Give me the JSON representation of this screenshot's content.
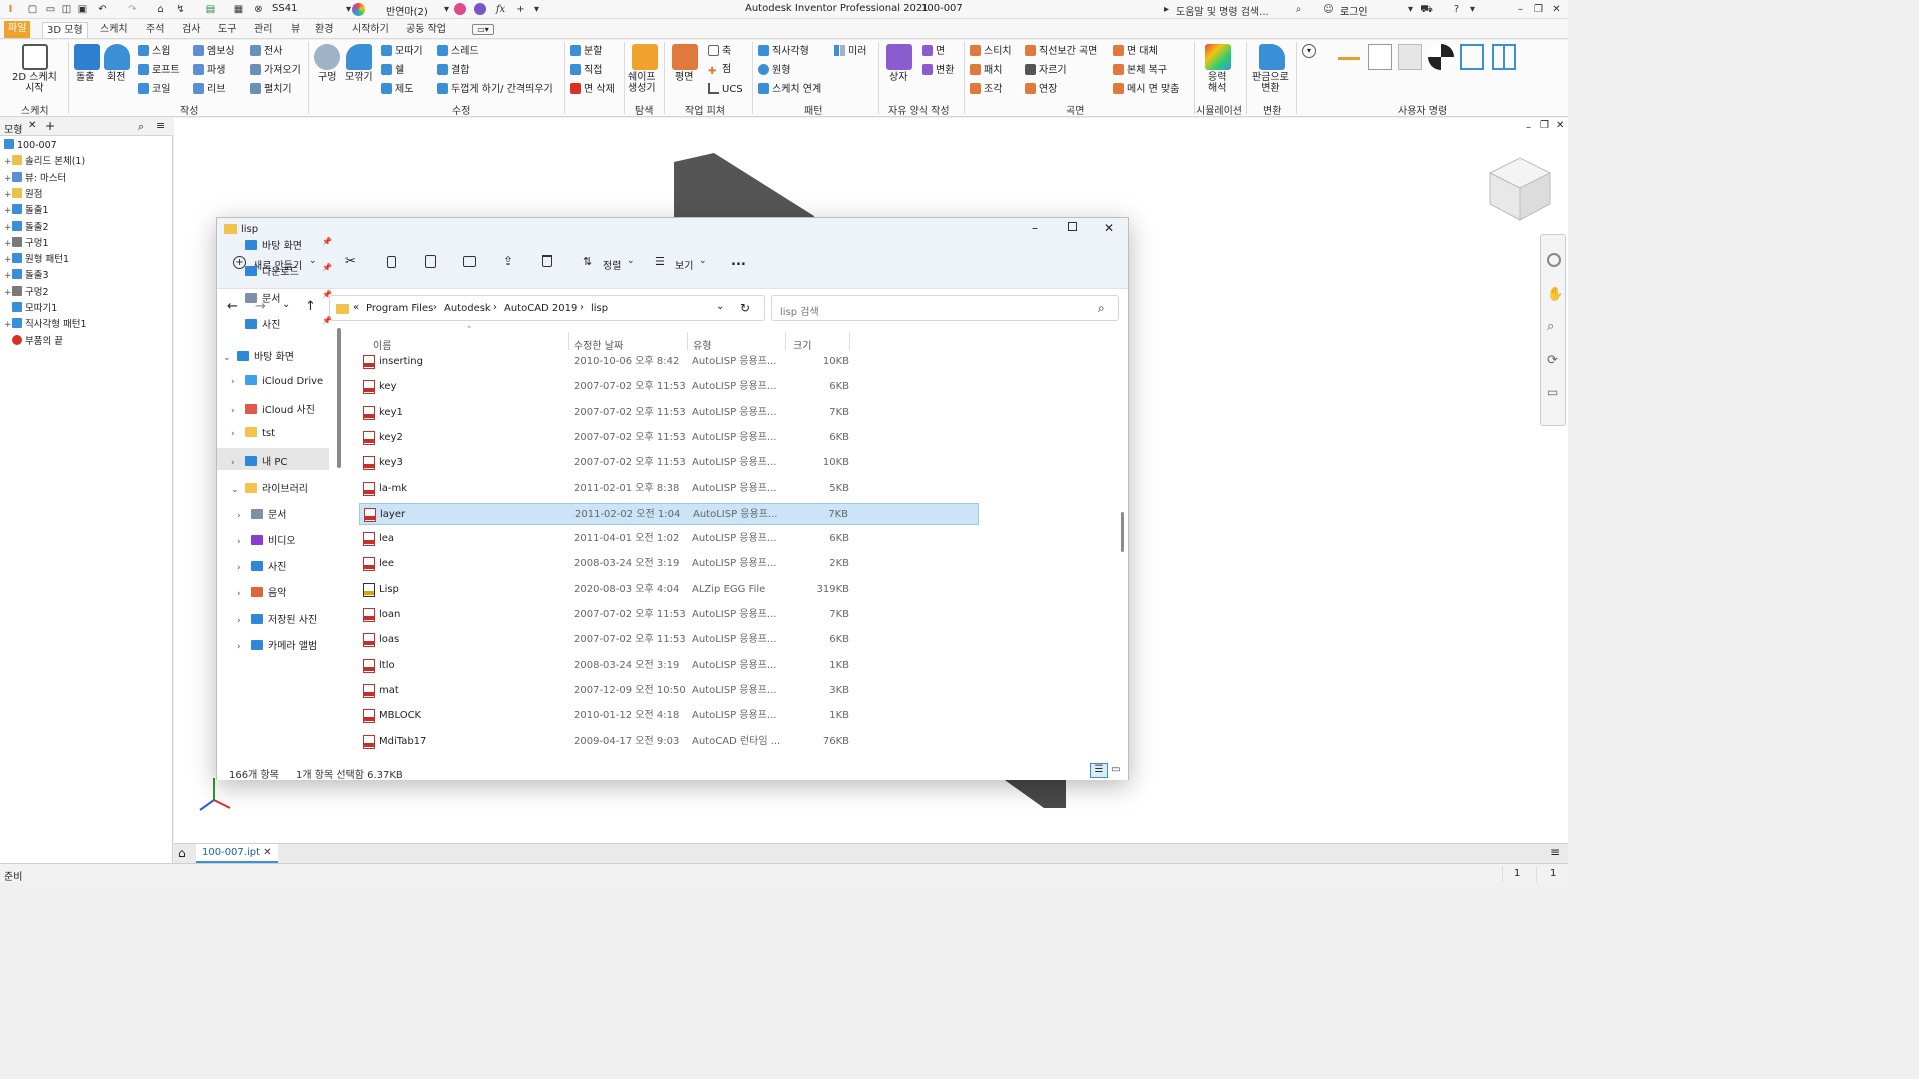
{
  "app": {
    "title": "Autodesk Inventor Professional 2021",
    "doc": "100-007",
    "search_placeholder": "도움말 및 명령 검색...",
    "login": "로그인",
    "style_name": "SS41",
    "appearance": "반연마(2)"
  },
  "ribbon_tabs": [
    "파일",
    "3D 모형",
    "스케치",
    "주석",
    "검사",
    "도구",
    "관리",
    "뷰",
    "환경",
    "시작하기",
    "공동 작업"
  ],
  "ribbon": {
    "sketch_btn": "2D 스케치\n시작",
    "sketch_panel": "스케치",
    "extrude": "돌출",
    "revolve": "회전",
    "sweep": "스윕",
    "loft": "로프트",
    "coil": "코일",
    "emboss": "엠보싱",
    "derive": "파생",
    "rib": "리브",
    "decal": "전사",
    "import": "가져오기",
    "unwrap": "펼치기",
    "create_panel": "작성",
    "hole": "구멍",
    "fillet": "모깎기",
    "chamfer": "모따기",
    "shell": "쉘",
    "draft": "제도",
    "thread": "스레드",
    "combine": "결합",
    "thicken": "두껍게 하기/ 간격띄우기",
    "modify_panel": "수정",
    "split": "분할",
    "direct": "직접",
    "delete_face": "면 삭제",
    "shape_gen": "쉐이프\n생성기",
    "explore_panel": "탐색",
    "plane": "평면",
    "axis": "축",
    "point": "점",
    "ucs": "UCS",
    "workfeat_panel": "작업 피쳐",
    "rect_pattern": "직사각형",
    "circ_pattern": "원형",
    "sketch_driven": "스케치 연계",
    "mirror": "미러",
    "pattern_panel": "패턴",
    "box": "상자",
    "face": "면",
    "convert": "변환",
    "freeform_panel": "자유 양식 작성",
    "stitch": "스티치",
    "patch": "패치",
    "sculpt": "조각",
    "ruled": "직선보간 곡면",
    "trim": "자르기",
    "extend": "연장",
    "replace_face": "면 대체",
    "repair": "본체 복구",
    "mesh_face": "메시 면 맞춤",
    "surface_panel": "곡면",
    "stress": "응력\n해석",
    "sim_panel": "시뮬레이션",
    "sheetmetal": "판금으로\n변환",
    "convert_panel": "변환",
    "user_panel": "사용자 명령"
  },
  "browser": {
    "tab": "모형",
    "items": [
      {
        "label": "100-007",
        "level": 0,
        "pm": "",
        "color": "#3a8fd6"
      },
      {
        "label": "솔리드 본체(1)",
        "level": 1,
        "pm": "+",
        "color": "#e8c24a"
      },
      {
        "label": "뷰: 마스터",
        "level": 1,
        "pm": "+",
        "color": "#5b8fd1"
      },
      {
        "label": "원점",
        "level": 1,
        "pm": "+",
        "color": "#e8c24a"
      },
      {
        "label": "돌출1",
        "level": 1,
        "pm": "+",
        "color": "#3a8fd6"
      },
      {
        "label": "돌출2",
        "level": 1,
        "pm": "+",
        "color": "#3a8fd6"
      },
      {
        "label": "구멍1",
        "level": 1,
        "pm": "+",
        "color": "#7a7a7a"
      },
      {
        "label": "원형 패턴1",
        "level": 1,
        "pm": "+",
        "color": "#3a8fd6"
      },
      {
        "label": "돌출3",
        "level": 1,
        "pm": "+",
        "color": "#3a8fd6"
      },
      {
        "label": "구멍2",
        "level": 1,
        "pm": "+",
        "color": "#7a7a7a"
      },
      {
        "label": "모따기1",
        "level": 1,
        "pm": "",
        "color": "#3a8fd6"
      },
      {
        "label": "직사각형 패턴1",
        "level": 1,
        "pm": "+",
        "color": "#3a8fd6"
      },
      {
        "label": "부품의 끝",
        "level": 1,
        "pm": "",
        "color": "#d93025"
      }
    ]
  },
  "explorer": {
    "title": "lisp",
    "new_btn": "새로 만들기",
    "sort_btn": "정렬",
    "view_btn": "보기",
    "more": "...",
    "breadcrumb": [
      "Program Files",
      "Autodesk",
      "AutoCAD 2019",
      "lisp"
    ],
    "search_placeholder": "lisp 검색",
    "nav": [
      {
        "label": "바탕 화면",
        "level": 1,
        "pin": true,
        "color": "#2f87d8",
        "chev": ""
      },
      {
        "label": "다운로드",
        "level": 1,
        "pin": true,
        "color": "#2f87d8",
        "chev": ""
      },
      {
        "label": "문서",
        "level": 1,
        "pin": true,
        "color": "#7f8fa6",
        "chev": ""
      },
      {
        "label": "사진",
        "level": 1,
        "pin": true,
        "color": "#2f87d8",
        "chev": ""
      },
      {
        "label": "바탕 화면",
        "level": 0,
        "pin": false,
        "color": "#2f87d8",
        "chev": "v"
      },
      {
        "label": "iCloud Drive",
        "level": 1,
        "pin": false,
        "color": "#3ca0e8",
        "chev": ">"
      },
      {
        "label": "iCloud 사진",
        "level": 1,
        "pin": false,
        "color": "#e0574c",
        "chev": ">"
      },
      {
        "label": "tst",
        "level": 1,
        "pin": false,
        "color": "#f1c34b",
        "chev": ">"
      },
      {
        "label": "내 PC",
        "level": 1,
        "pin": false,
        "color": "#2f87d8",
        "chev": ">"
      },
      {
        "label": "라이브러리",
        "level": 1,
        "pin": false,
        "color": "#f1c34b",
        "chev": "v"
      },
      {
        "label": "문서",
        "level": 2,
        "pin": false,
        "color": "#7f8fa6",
        "chev": ">"
      },
      {
        "label": "비디오",
        "level": 2,
        "pin": false,
        "color": "#8a3ccf",
        "chev": ">"
      },
      {
        "label": "사진",
        "level": 2,
        "pin": false,
        "color": "#2f87d8",
        "chev": ">"
      },
      {
        "label": "음악",
        "level": 2,
        "pin": false,
        "color": "#e2643c",
        "chev": ">"
      },
      {
        "label": "저장된 사진",
        "level": 2,
        "pin": false,
        "color": "#2f87d8",
        "chev": ">"
      },
      {
        "label": "카메라 앨범",
        "level": 2,
        "pin": false,
        "color": "#2f87d8",
        "chev": ">"
      }
    ],
    "columns": [
      "이름",
      "수정한 날짜",
      "유형",
      "크기"
    ],
    "files": [
      {
        "name": "inserting",
        "date": "2010-10-06 오후 8:42",
        "type": "AutoLISP 응용프...",
        "size": "10KB",
        "icon": "lsp"
      },
      {
        "name": "key",
        "date": "2007-07-02 오후 11:53",
        "type": "AutoLISP 응용프...",
        "size": "6KB",
        "icon": "lsp"
      },
      {
        "name": "key1",
        "date": "2007-07-02 오후 11:53",
        "type": "AutoLISP 응용프...",
        "size": "7KB",
        "icon": "lsp"
      },
      {
        "name": "key2",
        "date": "2007-07-02 오후 11:53",
        "type": "AutoLISP 응용프...",
        "size": "6KB",
        "icon": "lsp"
      },
      {
        "name": "key3",
        "date": "2007-07-02 오후 11:53",
        "type": "AutoLISP 응용프...",
        "size": "10KB",
        "icon": "lsp"
      },
      {
        "name": "la-mk",
        "date": "2011-02-01 오후 8:38",
        "type": "AutoLISP 응용프...",
        "size": "5KB",
        "icon": "lsp"
      },
      {
        "name": "layer",
        "date": "2011-02-02 오전 1:04",
        "type": "AutoLISP 응용프...",
        "size": "7KB",
        "icon": "lsp",
        "selected": true
      },
      {
        "name": "lea",
        "date": "2011-04-01 오전 1:02",
        "type": "AutoLISP 응용프...",
        "size": "6KB",
        "icon": "lsp"
      },
      {
        "name": "lee",
        "date": "2008-03-24 오전 3:19",
        "type": "AutoLISP 응용프...",
        "size": "2KB",
        "icon": "lsp"
      },
      {
        "name": "Lisp",
        "date": "2020-08-03 오후 4:04",
        "type": "ALZip EGG File",
        "size": "319KB",
        "icon": "egg"
      },
      {
        "name": "loan",
        "date": "2007-07-02 오후 11:53",
        "type": "AutoLISP 응용프...",
        "size": "7KB",
        "icon": "lsp"
      },
      {
        "name": "loas",
        "date": "2007-07-02 오후 11:53",
        "type": "AutoLISP 응용프...",
        "size": "6KB",
        "icon": "lsp"
      },
      {
        "name": "ltlo",
        "date": "2008-03-24 오전 3:19",
        "type": "AutoLISP 응용프...",
        "size": "1KB",
        "icon": "lsp"
      },
      {
        "name": "mat",
        "date": "2007-12-09 오전 10:50",
        "type": "AutoLISP 응용프...",
        "size": "3KB",
        "icon": "lsp"
      },
      {
        "name": "MBLOCK",
        "date": "2010-01-12 오전 4:18",
        "type": "AutoLISP 응용프...",
        "size": "1KB",
        "icon": "lsp"
      },
      {
        "name": "MdiTab17",
        "date": "2009-04-17 오전 9:03",
        "type": "AutoCAD 런타임 ...",
        "size": "76KB",
        "icon": "lsp"
      }
    ],
    "item_count": "166개 항목",
    "selection": "1개 항목 선택함 6.37KB"
  },
  "doc_tab": "100-007.ipt",
  "statusbar": {
    "left": "준비",
    "r1": "1",
    "r2": "1"
  }
}
